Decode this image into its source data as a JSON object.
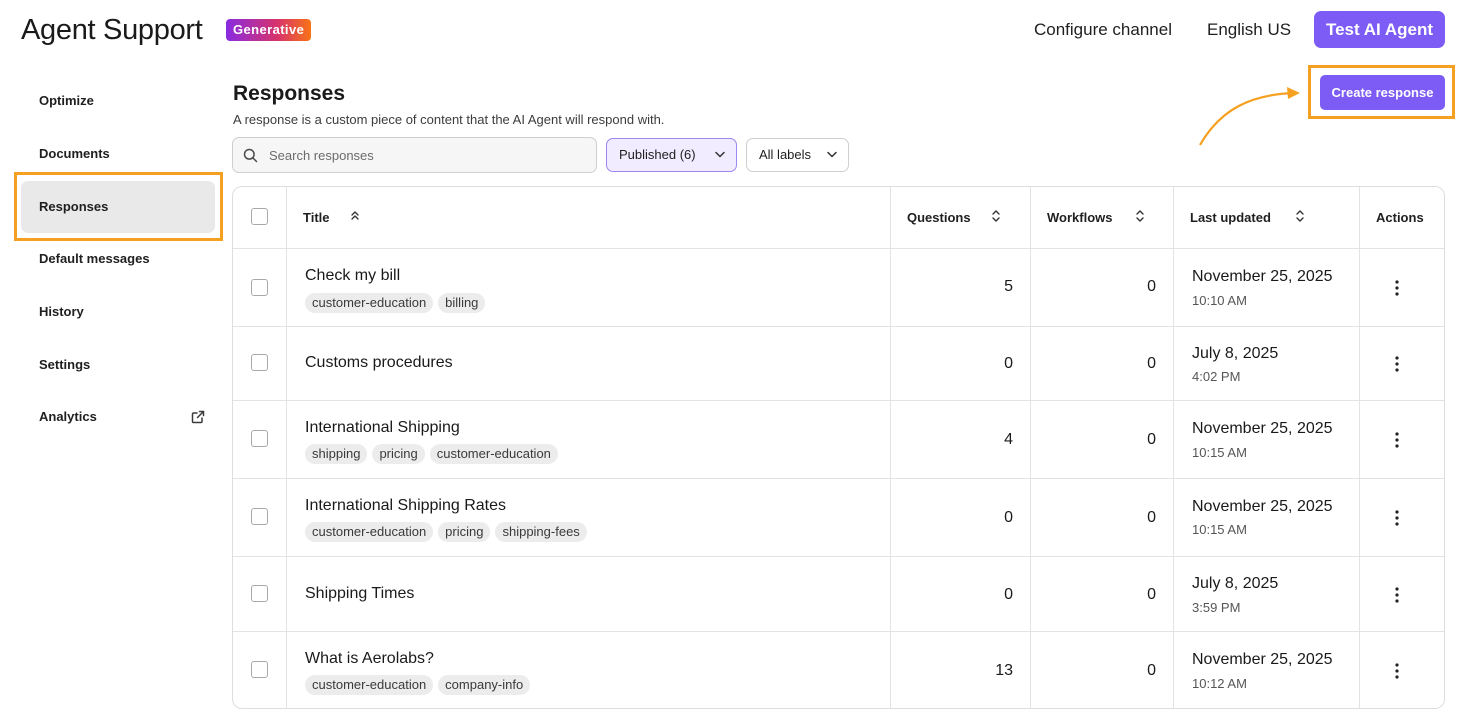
{
  "header": {
    "app_title": "Agent Support",
    "badge": "Generative",
    "configure_channel": "Configure channel",
    "language": "English US",
    "test_button": "Test AI Agent"
  },
  "sidebar": {
    "items": [
      {
        "label": "Optimize"
      },
      {
        "label": "Documents"
      },
      {
        "label": "Responses",
        "active": true
      },
      {
        "label": "Default messages"
      },
      {
        "label": "History"
      },
      {
        "label": "Settings"
      },
      {
        "label": "Analytics",
        "icon": "external-link-icon"
      }
    ]
  },
  "main": {
    "title": "Responses",
    "description": "A response is a custom piece of content that the AI Agent will respond with.",
    "create_button": "Create response",
    "search": {
      "placeholder": "Search responses",
      "value": ""
    },
    "filters": {
      "published": "Published (6)",
      "labels": "All labels"
    },
    "table": {
      "columns": {
        "title": "Title",
        "questions": "Questions",
        "workflows": "Workflows",
        "last_updated": "Last updated",
        "actions": "Actions"
      },
      "rows": [
        {
          "title": "Check my bill",
          "tags": [
            "customer-education",
            "billing"
          ],
          "questions": "5",
          "workflows": "0",
          "date": "November 25, 2025",
          "time": "10:10 AM"
        },
        {
          "title": "Customs procedures",
          "tags": [],
          "questions": "0",
          "workflows": "0",
          "date": "July 8, 2025",
          "time": "4:02 PM"
        },
        {
          "title": "International Shipping",
          "tags": [
            "shipping",
            "pricing",
            "customer-education"
          ],
          "questions": "4",
          "workflows": "0",
          "date": "November 25, 2025",
          "time": "10:15 AM"
        },
        {
          "title": "International Shipping Rates",
          "tags": [
            "customer-education",
            "pricing",
            "shipping-fees"
          ],
          "questions": "0",
          "workflows": "0",
          "date": "November 25, 2025",
          "time": "10:15 AM"
        },
        {
          "title": "Shipping Times",
          "tags": [],
          "questions": "0",
          "workflows": "0",
          "date": "July 8, 2025",
          "time": "3:59 PM"
        },
        {
          "title": "What is Aerolabs?",
          "tags": [
            "customer-education",
            "company-info"
          ],
          "questions": "13",
          "workflows": "0",
          "date": "November 25, 2025",
          "time": "10:12 AM"
        }
      ]
    }
  },
  "colors": {
    "accent": "#7c5cf5",
    "highlight": "#f5a020",
    "badge_gradient": [
      "#8a2be2",
      "#d6336c",
      "#f97316"
    ]
  }
}
